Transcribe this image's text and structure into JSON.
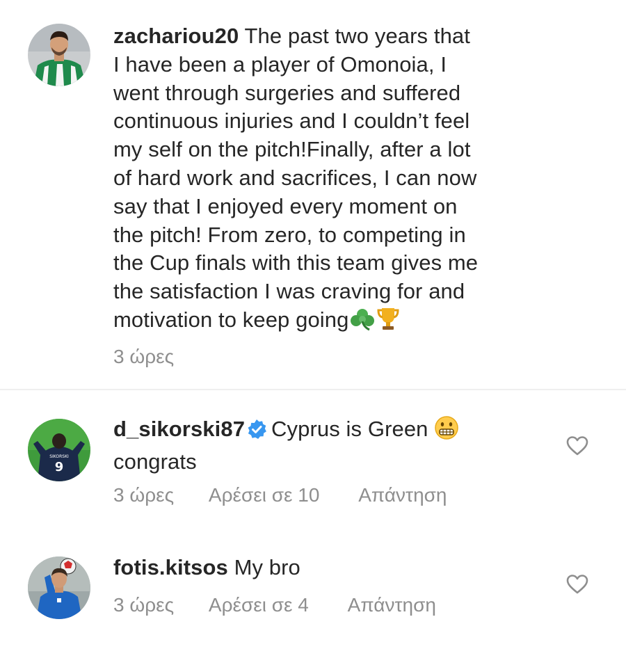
{
  "caption": {
    "username": "zachariou20",
    "lines": [
      "The past two years that",
      "I have been a player of Omonoia, I",
      "went through surgeries and suffered",
      "continuous injuries and I couldn’t feel",
      "my self on the pitch!Finally, after a lot",
      "of hard work and sacrifices, I can now",
      "say that I enjoyed every moment on",
      "the pitch! From zero, to competing in",
      "the Cup finals with this team gives me",
      "the satisfaction I was craving for and",
      "motivation to keep going"
    ],
    "emojis": [
      "shamrock-emoji",
      "trophy-emoji"
    ],
    "time": "3 ώρες"
  },
  "comments": [
    {
      "username": "d_sikorski87",
      "verified": true,
      "text_line1": "Cyprus is Green",
      "emoji": "grimacing-face-emoji",
      "text_line2": "congrats",
      "time": "3 ώρες",
      "likes": "Αρέσει σε 10",
      "reply": "Απάντηση",
      "like_icon": "heart-outline-icon"
    },
    {
      "username": "fotis.kitsos",
      "verified": false,
      "text": "My bro",
      "time": "3 ώρες",
      "likes": "Αρέσει σε 4",
      "reply": "Απάντηση",
      "like_icon": "heart-outline-icon"
    }
  ],
  "colors": {
    "text": "#262626",
    "secondary": "#8e8e8e",
    "verified_blue": "#3897f0",
    "divider": "#efefef"
  }
}
